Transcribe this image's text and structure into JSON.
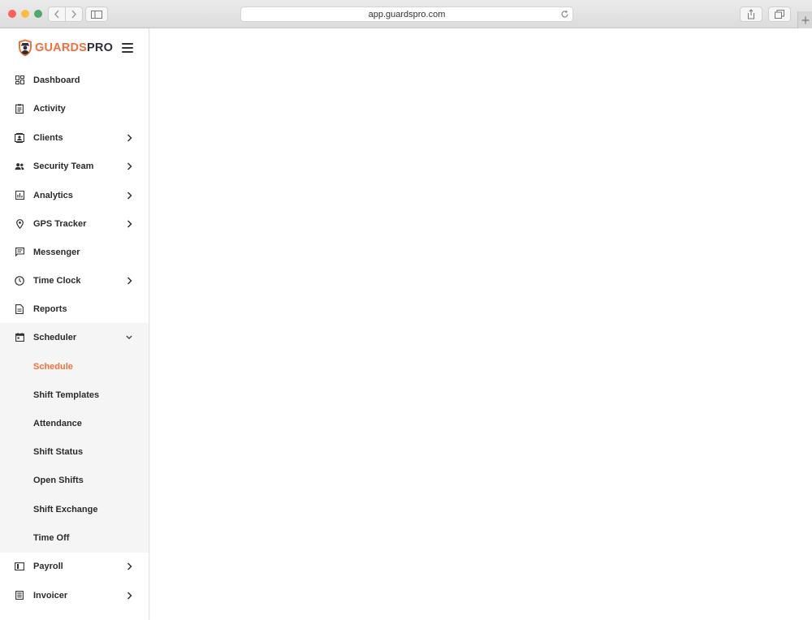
{
  "browser": {
    "url": "app.guardspro.com"
  },
  "brand": {
    "part1": "GUARDS",
    "part2": "PRO",
    "accent_color": "#f36f3c"
  },
  "menu": {
    "dashboard": "Dashboard",
    "activity": "Activity",
    "clients": "Clients",
    "security_team": "Security Team",
    "analytics": "Analytics",
    "gps_tracker": "GPS Tracker",
    "messenger": "Messenger",
    "time_clock": "Time Clock",
    "reports": "Reports",
    "scheduler": "Scheduler",
    "payroll": "Payroll",
    "invoicer": "Invoicer"
  },
  "scheduler_sub": {
    "schedule": "Schedule",
    "shift_templates": "Shift Templates",
    "attendance": "Attendance",
    "shift_status": "Shift Status",
    "open_shifts": "Open Shifts",
    "shift_exchange": "Shift Exchange",
    "time_off": "Time Off"
  },
  "active_item": "Schedule"
}
